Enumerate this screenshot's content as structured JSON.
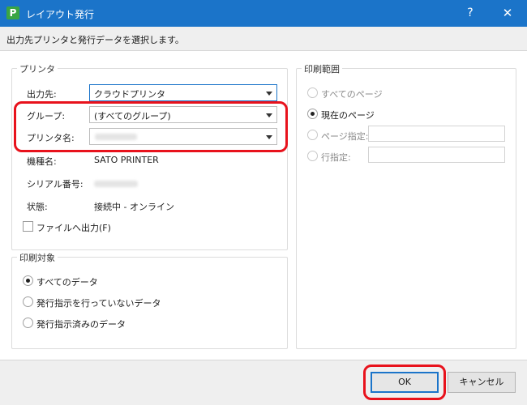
{
  "window": {
    "app_icon": "P",
    "title": "レイアウト発行",
    "help_label": "?",
    "close_label": "✕"
  },
  "description": "出力先プリンタと発行データを選択します。",
  "printer_group": {
    "title": "プリンタ",
    "output_label": "出力先:",
    "output_value": "クラウドプリンタ",
    "group_label": "グループ:",
    "group_value": "(すべてのグループ)",
    "printer_label": "プリンタ名:",
    "model_label": "機種名:",
    "model_value": "SATO PRINTER",
    "serial_label": "シリアル番号:",
    "status_label": "状態:",
    "status_value": "接続中 - オンライン",
    "file_output_label": "ファイルへ出力(F)"
  },
  "target_group": {
    "title": "印刷対象",
    "options": [
      "すべてのデータ",
      "発行指示を行っていないデータ",
      "発行指示済みのデータ"
    ]
  },
  "range_group": {
    "title": "印刷範囲",
    "options": [
      "すべてのページ",
      "現在のページ",
      "ページ指定:",
      "行指定:"
    ]
  },
  "footer": {
    "ok_label": "OK",
    "cancel_label": "キャンセル"
  },
  "colors": {
    "titlebar": "#1b74c9",
    "highlight": "#e8121c"
  }
}
